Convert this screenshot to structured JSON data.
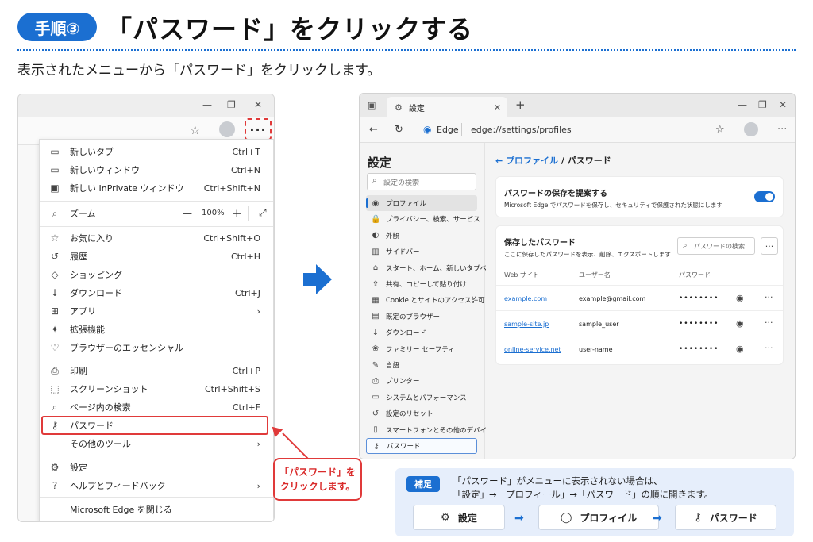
{
  "header": {
    "step_badge": "手順③",
    "title": "「パスワード」をクリックする",
    "subtitle": "表示されたメニューから「パスワード」をクリックします。"
  },
  "left_window": {
    "window_controls": [
      "—",
      "❐",
      "✕"
    ],
    "more_button": "···",
    "menu": [
      {
        "icon": "new-tab-icon",
        "glyph": "▭",
        "label": "新しいタブ",
        "shortcut": "Ctrl+T"
      },
      {
        "icon": "new-window-icon",
        "glyph": "▭",
        "label": "新しいウィンドウ",
        "shortcut": "Ctrl+N"
      },
      {
        "icon": "inprivate-icon",
        "glyph": "▣",
        "label": "新しい InPrivate ウィンドウ",
        "shortcut": "Ctrl+Shift+N"
      },
      {
        "icon": "zoom-icon",
        "glyph": "⌕",
        "label": "ズーム",
        "shortcut": ""
      },
      {
        "icon": "favorites-icon",
        "glyph": "☆",
        "label": "お気に入り",
        "shortcut": "Ctrl+Shift+O"
      },
      {
        "icon": "history-icon",
        "glyph": "↺",
        "label": "履歴",
        "shortcut": "Ctrl+H"
      },
      {
        "icon": "shopping-icon",
        "glyph": "◇",
        "label": "ショッピング",
        "shortcut": ""
      },
      {
        "icon": "download-icon",
        "glyph": "↓",
        "label": "ダウンロード",
        "shortcut": "Ctrl+J"
      },
      {
        "icon": "apps-icon",
        "glyph": "⊞",
        "label": "アプリ",
        "shortcut": "›"
      },
      {
        "icon": "extensions-icon",
        "glyph": "✦",
        "label": "拡張機能",
        "shortcut": ""
      },
      {
        "icon": "essentials-icon",
        "glyph": "♡",
        "label": "ブラウザーのエッセンシャル",
        "shortcut": ""
      },
      {
        "icon": "print-icon",
        "glyph": "⎙",
        "label": "印刷",
        "shortcut": "Ctrl+P"
      },
      {
        "icon": "screenshot-icon",
        "glyph": "⬚",
        "label": "スクリーンショット",
        "shortcut": "Ctrl+Shift+S"
      },
      {
        "icon": "find-icon",
        "glyph": "⌕",
        "label": "ページ内の検索",
        "shortcut": "Ctrl+F"
      },
      {
        "icon": "password-key-icon",
        "glyph": "⚷",
        "label": "パスワード",
        "shortcut": ""
      },
      {
        "icon": "more-tools-icon",
        "glyph": "",
        "label": "その他のツール",
        "shortcut": "›"
      },
      {
        "icon": "settings-gear-icon",
        "glyph": "⚙",
        "label": "設定",
        "shortcut": ""
      },
      {
        "icon": "help-icon",
        "glyph": "?",
        "label": "ヘルプとフィードバック",
        "shortcut": "›"
      },
      {
        "icon": "close-edge-icon",
        "glyph": "",
        "label": "Microsoft Edge を閉じる",
        "shortcut": ""
      }
    ],
    "zoom": {
      "minus": "—",
      "value": "100%",
      "plus": "+",
      "expand": "⤢"
    }
  },
  "callout": {
    "line1": "「パスワード」を",
    "line2": "クリックします。"
  },
  "right_window": {
    "tab_label": "設定",
    "address_brand": "Edge",
    "url": "edge://settings/profiles",
    "sidebar_title": "設定",
    "search_placeholder": "設定の検索",
    "sidebar_items": [
      {
        "icon": "profile-icon",
        "glyph": "◉",
        "label": "プロファイル"
      },
      {
        "icon": "privacy-icon",
        "glyph": "🔒",
        "label": "プライバシー、検索、サービス"
      },
      {
        "icon": "appearance-icon",
        "glyph": "◐",
        "label": "外観"
      },
      {
        "icon": "sidebar-icon",
        "glyph": "▥",
        "label": "サイドバー"
      },
      {
        "icon": "start-home-icon",
        "glyph": "⌂",
        "label": "スタート、ホーム、新しいタブページ"
      },
      {
        "icon": "share-icon",
        "glyph": "⇪",
        "label": "共有、コピーして貼り付け"
      },
      {
        "icon": "cookie-icon",
        "glyph": "▦",
        "label": "Cookie とサイトのアクセス許可"
      },
      {
        "icon": "default-browser-icon",
        "glyph": "▤",
        "label": "既定のブラウザー"
      },
      {
        "icon": "download-icon",
        "glyph": "↓",
        "label": "ダウンロード"
      },
      {
        "icon": "family-icon",
        "glyph": "❀",
        "label": "ファミリー セーフティ"
      },
      {
        "icon": "language-icon",
        "glyph": "✎",
        "label": "言語"
      },
      {
        "icon": "printer-icon",
        "glyph": "⎙",
        "label": "プリンター"
      },
      {
        "icon": "system-icon",
        "glyph": "▭",
        "label": "システムとパフォーマンス"
      },
      {
        "icon": "reset-icon",
        "glyph": "↺",
        "label": "設定のリセット"
      },
      {
        "icon": "phone-icon",
        "glyph": "▯",
        "label": "スマートフォンとその他のデバイス"
      },
      {
        "icon": "password-key-icon",
        "glyph": "⚷",
        "label": "パスワード"
      }
    ],
    "breadcrumb_back": "←",
    "breadcrumb_parent": "プロファイル",
    "breadcrumb_sep": " / ",
    "breadcrumb_current": "パスワード",
    "offer_title": "パスワードの保存を提案する",
    "offer_desc": "Microsoft Edge でパスワードを保存し、セキュリティで保護された状態にします",
    "saved_title": "保存したパスワード",
    "saved_desc": "ここに保存したパスワードを表示、削除、エクスポートします",
    "pw_search_placeholder": "パスワードの検索",
    "columns": [
      "Web サイト",
      "ユーザー名",
      "パスワード"
    ],
    "rows": [
      {
        "site": "example.com",
        "user": "example@gmail.com",
        "password": "••••••••"
      },
      {
        "site": "sample-site.jp",
        "user": "sample_user",
        "password": "••••••••"
      },
      {
        "site": "online-service.net",
        "user": "user-name",
        "password": "••••••••"
      }
    ]
  },
  "hint": {
    "badge": "補足",
    "line1": "「パスワード」がメニューに表示されない場合は、",
    "line2": "「設定」→「プロフィール」→「パスワード」の順に開きます。",
    "buttons": [
      "設定",
      "プロフィイル",
      "パスワード"
    ]
  },
  "colors": {
    "accent": "#1b6fd1",
    "highlight": "#e03a3a"
  }
}
